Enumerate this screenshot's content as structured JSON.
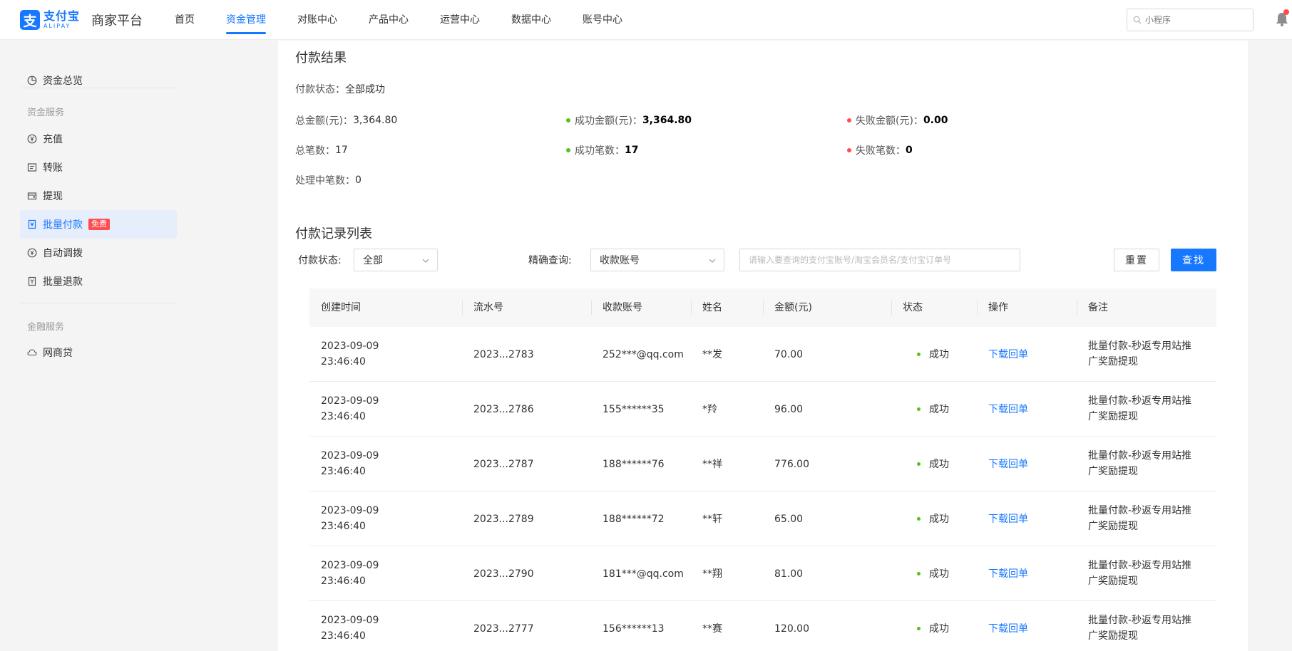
{
  "header": {
    "logo_cn": "支付宝",
    "logo_en": "ALIPAY",
    "platform": "商家平台",
    "nav": [
      "首页",
      "资金管理",
      "对账中心",
      "产品中心",
      "运营中心",
      "数据中心",
      "账号中心"
    ],
    "active_nav": "资金管理",
    "search_placeholder": "小程序"
  },
  "sidebar": {
    "overview": "资金总览",
    "group_fund": "资金服务",
    "items": [
      "充值",
      "转账",
      "提现",
      "批量付款",
      "自动调拨",
      "批量退款"
    ],
    "active_item": "批量付款",
    "badge": "免费",
    "group_finance": "金融服务",
    "finance_items": [
      "网商贷"
    ]
  },
  "result": {
    "title": "付款结果",
    "status_label": "付款状态：",
    "status_value": "全部成功",
    "total_amount_label": "总金额(元)：",
    "total_amount": "3,364.80",
    "success_amount_label": "成功金额(元)：",
    "success_amount": "3,364.80",
    "fail_amount_label": "失败金额(元)：",
    "fail_amount": "0.00",
    "total_count_label": "总笔数：",
    "total_count": "17",
    "success_count_label": "成功笔数：",
    "success_count": "17",
    "fail_count_label": "失败笔数：",
    "fail_count": "0",
    "processing_label": "处理中笔数：",
    "processing_count": "0"
  },
  "list": {
    "title": "付款记录列表",
    "status_filter_label": "付款状态:",
    "status_filter_value": "全部",
    "exact_query_label": "精确查询:",
    "exact_query_value": "收款账号",
    "query_placeholder": "请输入要查询的支付宝账号/淘宝会员名/支付宝订单号",
    "reset_button": "重置",
    "search_button": "查找",
    "columns": [
      "创建时间",
      "流水号",
      "收款账号",
      "姓名",
      "金额(元)",
      "状态",
      "操作",
      "备注"
    ],
    "rows": [
      {
        "date": "2023-09-09",
        "time": "23:46:40",
        "serial": "2023...2783",
        "account": "252***@qq.com",
        "name": "**发",
        "amount": "70.00",
        "status": "成功",
        "action": "下载回单",
        "remark1": "批量付款-秒返专用站推",
        "remark2": "广奖励提现"
      },
      {
        "date": "2023-09-09",
        "time": "23:46:40",
        "serial": "2023...2786",
        "account": "155******35",
        "name": "*羚",
        "amount": "96.00",
        "status": "成功",
        "action": "下载回单",
        "remark1": "批量付款-秒返专用站推",
        "remark2": "广奖励提现"
      },
      {
        "date": "2023-09-09",
        "time": "23:46:40",
        "serial": "2023...2787",
        "account": "188******76",
        "name": "**祥",
        "amount": "776.00",
        "status": "成功",
        "action": "下载回单",
        "remark1": "批量付款-秒返专用站推",
        "remark2": "广奖励提现"
      },
      {
        "date": "2023-09-09",
        "time": "23:46:40",
        "serial": "2023...2789",
        "account": "188******72",
        "name": "**轩",
        "amount": "65.00",
        "status": "成功",
        "action": "下载回单",
        "remark1": "批量付款-秒返专用站推",
        "remark2": "广奖励提现"
      },
      {
        "date": "2023-09-09",
        "time": "23:46:40",
        "serial": "2023...2790",
        "account": "181***@qq.com",
        "name": "**翔",
        "amount": "81.00",
        "status": "成功",
        "action": "下载回单",
        "remark1": "批量付款-秒返专用站推",
        "remark2": "广奖励提现"
      },
      {
        "date": "2023-09-09",
        "time": "23:46:40",
        "serial": "2023...2777",
        "account": "156******13",
        "name": "**赛",
        "amount": "120.00",
        "status": "成功",
        "action": "下载回单",
        "remark1": "批量付款-秒返专用站推",
        "remark2": "广奖励提现"
      }
    ]
  },
  "colors": {
    "accent": "#1677ff",
    "success": "#52c41a",
    "danger": "#ff4d4f"
  }
}
